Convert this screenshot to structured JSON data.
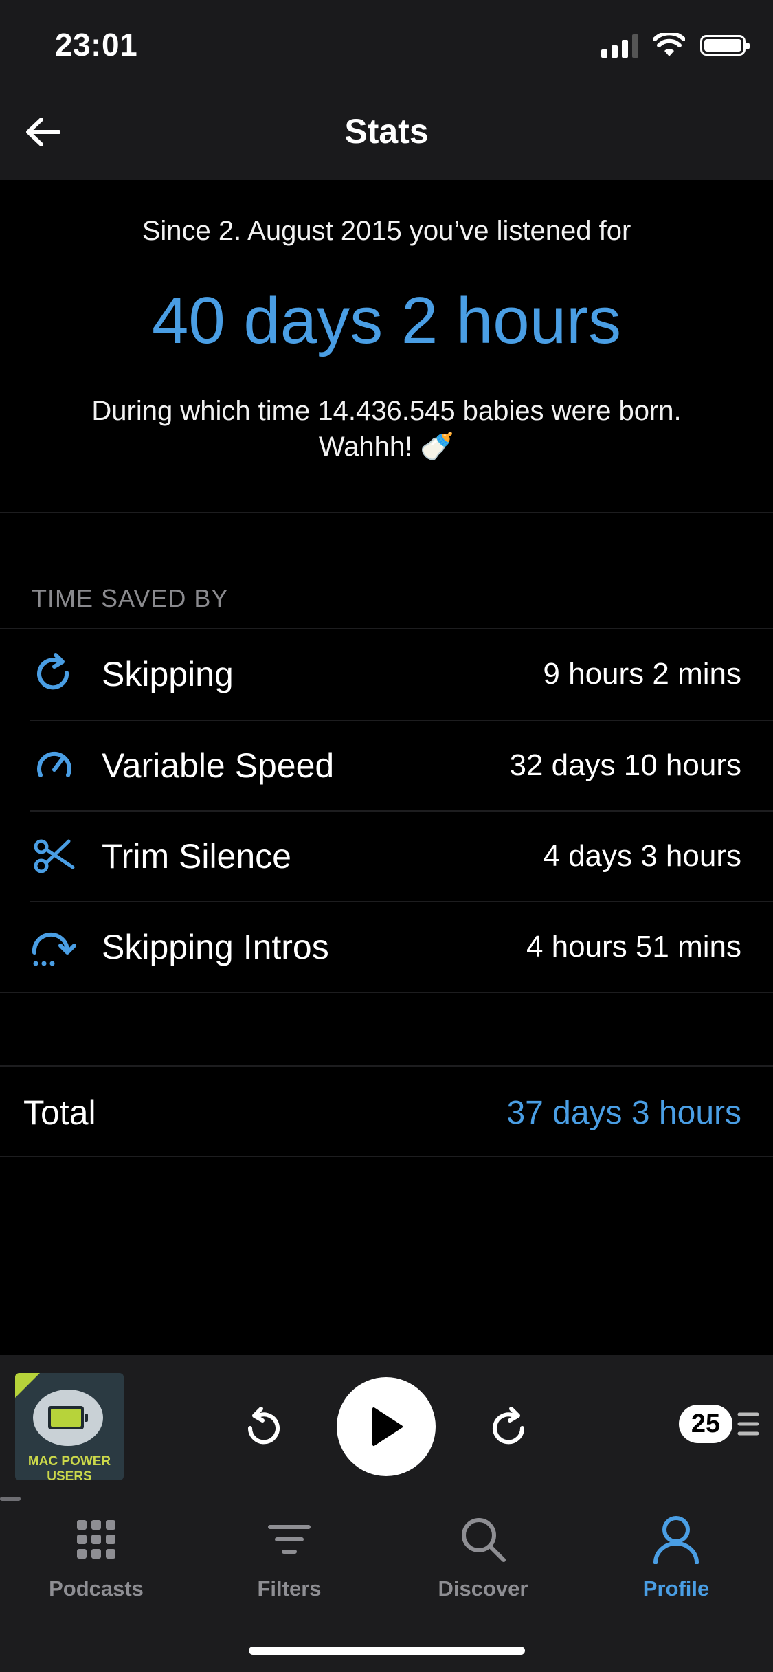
{
  "status_bar": {
    "time": "23:01"
  },
  "header": {
    "title": "Stats"
  },
  "summary": {
    "since_text": "Since 2. August 2015 you’ve listened for",
    "listened_total": "40 days 2 hours",
    "fun_fact": "During which time 14.436.545 babies were born. Wahhh! 🍼"
  },
  "time_saved": {
    "header": "TIME SAVED BY",
    "rows": [
      {
        "label": "Skipping",
        "value": "9 hours 2 mins",
        "icon": "skip-icon"
      },
      {
        "label": "Variable Speed",
        "value": "32 days 10 hours",
        "icon": "speedometer-icon"
      },
      {
        "label": "Trim Silence",
        "value": "4 days 3 hours",
        "icon": "scissors-icon"
      },
      {
        "label": "Skipping Intros",
        "value": "4 hours 51 mins",
        "icon": "skip-intro-icon"
      }
    ],
    "total_label": "Total",
    "total_value": "37 days 3 hours"
  },
  "player": {
    "artwork_text": "MAC POWER USERS",
    "speed": "25",
    "progress": 0.03
  },
  "tabs": [
    {
      "label": "Podcasts",
      "icon": "grid-icon",
      "active": false
    },
    {
      "label": "Filters",
      "icon": "filter-icon",
      "active": false
    },
    {
      "label": "Discover",
      "icon": "search-icon",
      "active": false
    },
    {
      "label": "Profile",
      "icon": "profile-icon",
      "active": true
    }
  ],
  "colors": {
    "accent": "#4a9ee4",
    "background": "#000000",
    "bar": "#1c1c1e"
  }
}
